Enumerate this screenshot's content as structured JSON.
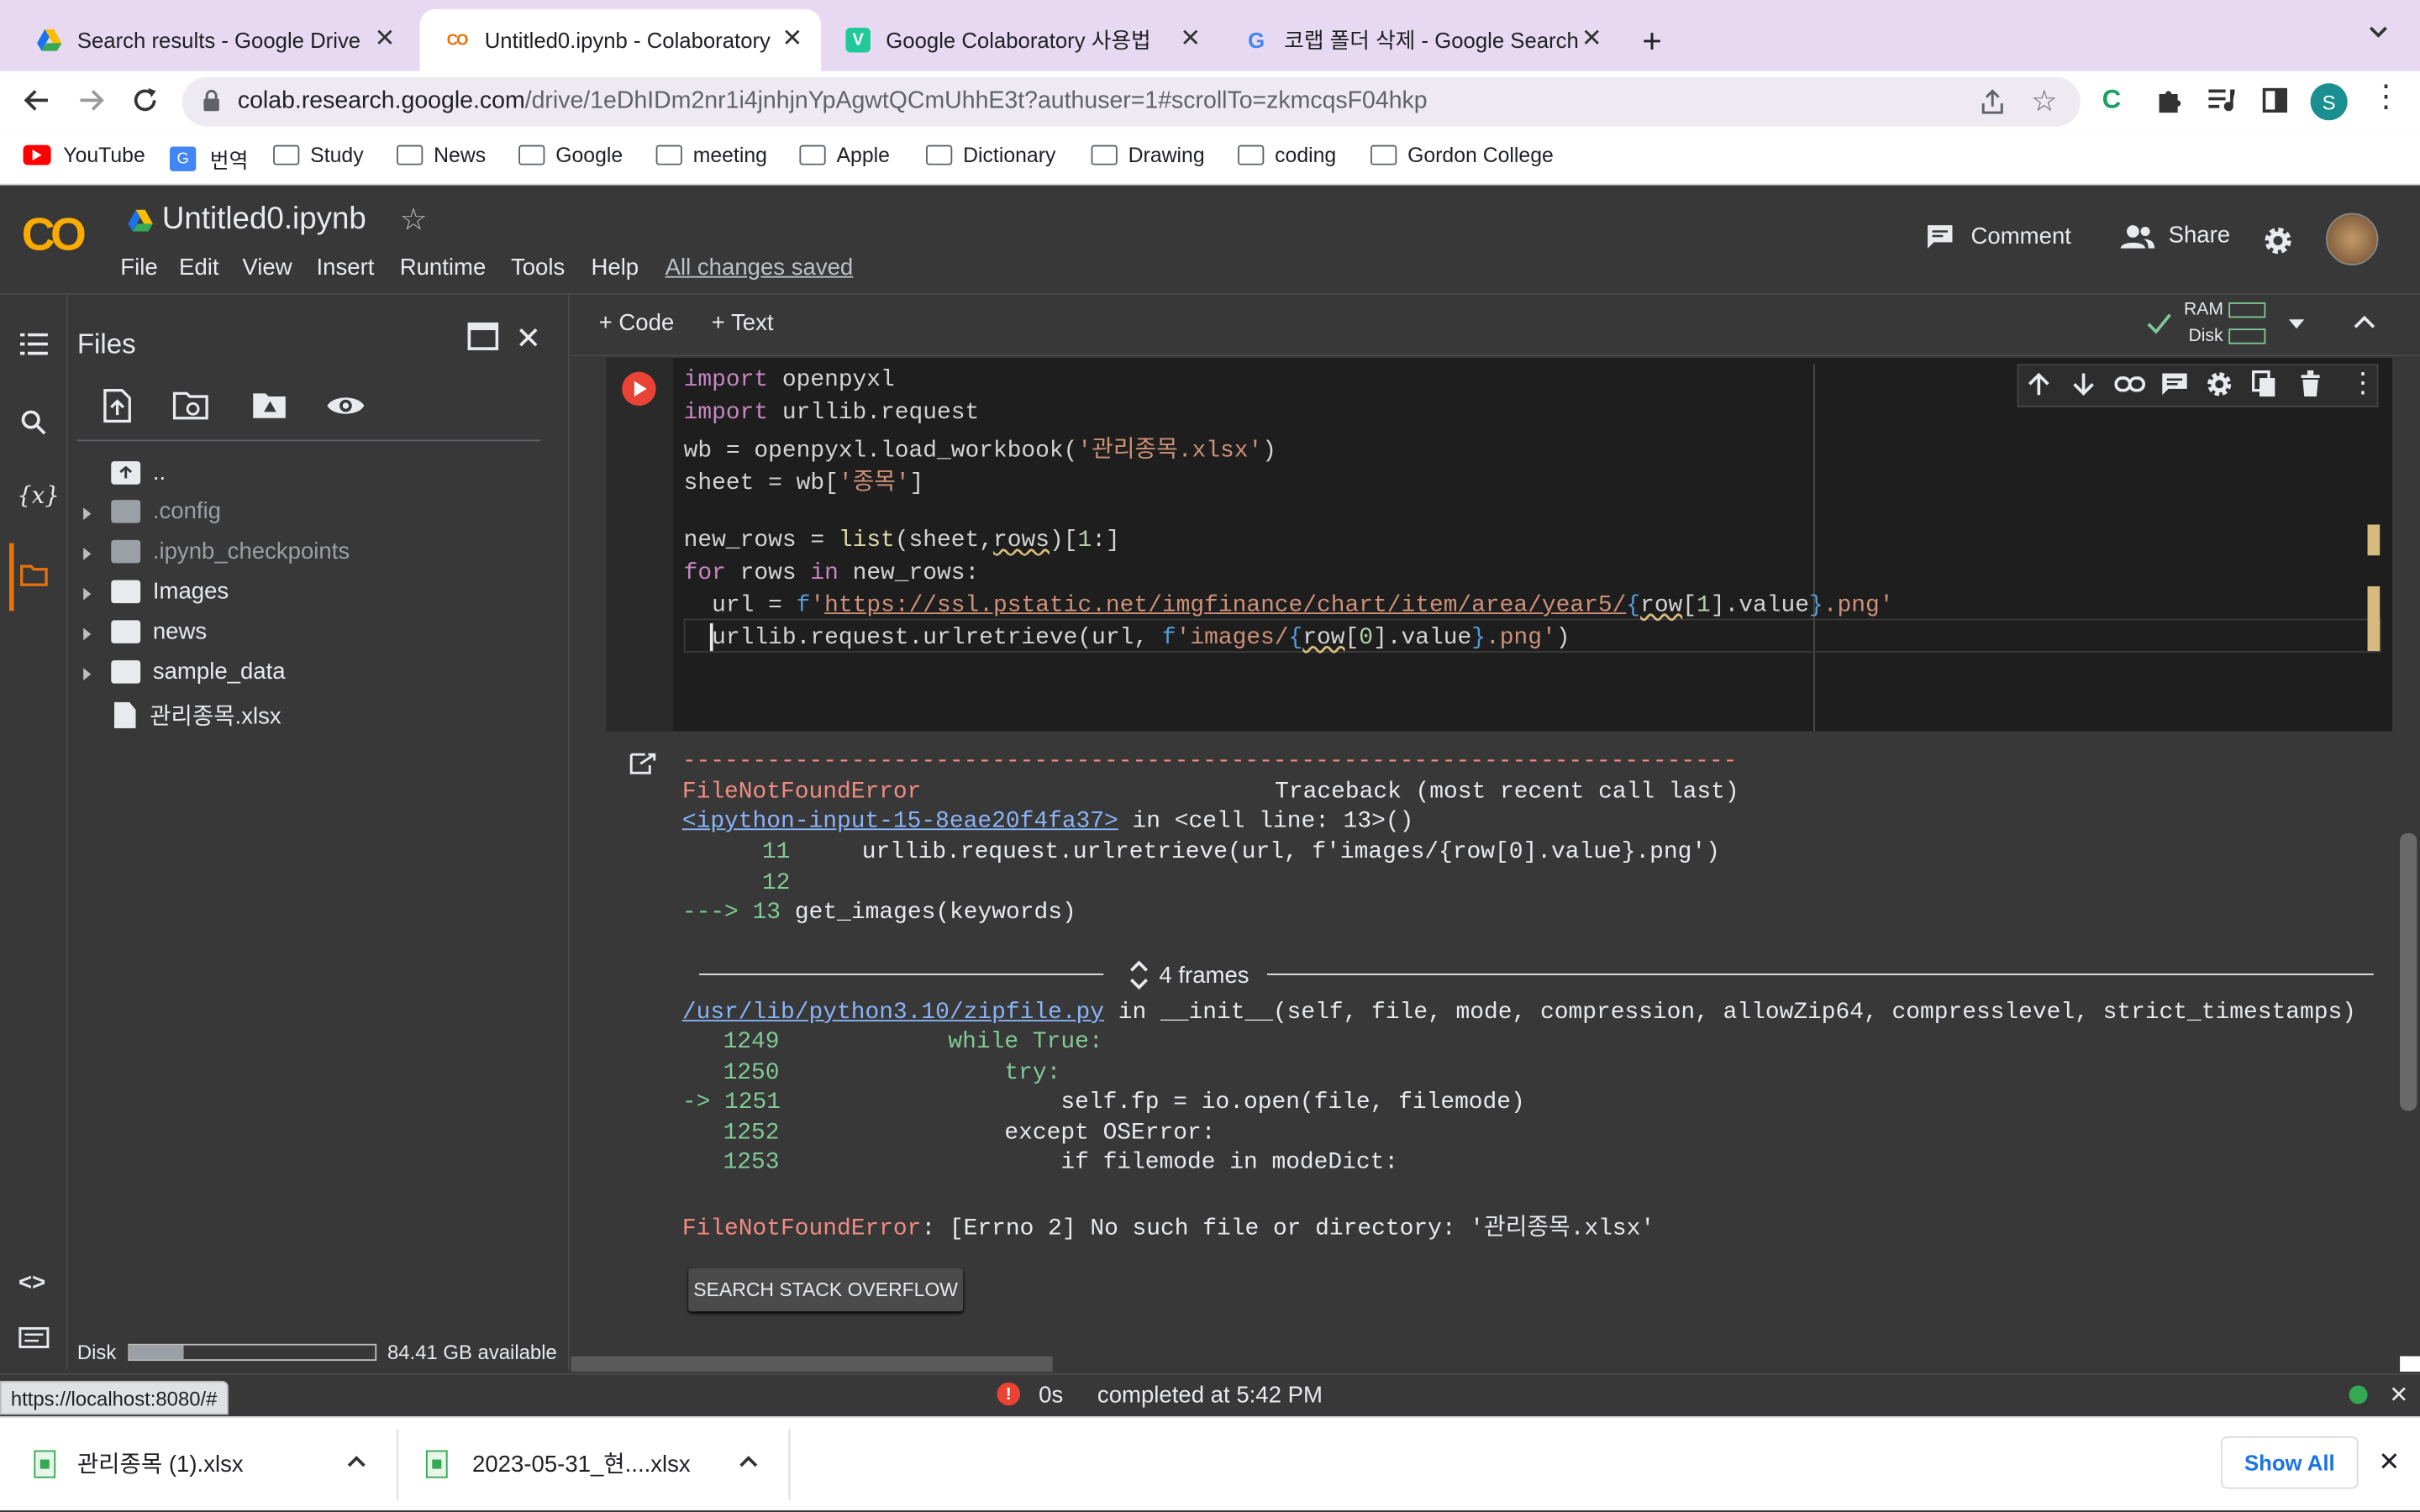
{
  "browser": {
    "tabs": [
      {
        "title": "Search results - Google Drive",
        "icon": "google-drive-icon"
      },
      {
        "title": "Untitled0.ipynb - Colaboratory",
        "icon": "colab-icon",
        "active": true
      },
      {
        "title": "Google Colaboratory 사용법",
        "icon": "velog-icon"
      },
      {
        "title": "코랩 폴더 삭제 - Google Search",
        "icon": "google-icon"
      }
    ],
    "url_host": "colab.research.google.com",
    "url_path": "/drive/1eDhIDm2nr1i4jnhjnYpAgwtQCmUhhE3t?authuser=1#scrollTo=zkmcqsF04hkp",
    "profile_initial": "S",
    "ext_letter": "C",
    "bookmarks": [
      "YouTube",
      "번역",
      "Study",
      "News",
      "Google",
      "meeting",
      "Apple",
      "Dictionary",
      "Drawing",
      "coding",
      "Gordon College"
    ]
  },
  "colab": {
    "logo": "CO",
    "notebook_name": "Untitled0.ipynb",
    "menu": [
      "File",
      "Edit",
      "View",
      "Insert",
      "Runtime",
      "Tools",
      "Help"
    ],
    "save_status": "All changes saved",
    "comment_label": "Comment",
    "share_label": "Share",
    "add_code_label": "+ Code",
    "add_text_label": "+ Text",
    "ram_label": "RAM",
    "disk_label": "Disk",
    "colors": {
      "background": "#383838",
      "accent": "#f9ab00",
      "error": "#f28b82",
      "link": "#8ab4f8"
    }
  },
  "files_panel": {
    "title": "Files",
    "items": [
      {
        "name": "..",
        "type": "up"
      },
      {
        "name": ".config",
        "type": "folder"
      },
      {
        "name": ".ipynb_checkpoints",
        "type": "folder"
      },
      {
        "name": "Images",
        "type": "folder"
      },
      {
        "name": "news",
        "type": "folder"
      },
      {
        "name": "sample_data",
        "type": "folder"
      },
      {
        "name": "관리종목.xlsx",
        "type": "file"
      }
    ],
    "disk_label": "Disk",
    "disk_available": "84.41 GB available",
    "disk_used_fraction": 0.22
  },
  "cell": {
    "code_lines": [
      "import openpyxl",
      "import urllib.request",
      "wb = openpyxl.load_workbook('관리종목.xlsx')",
      "sheet = wb['종목']",
      "",
      "new_rows = list(sheet,rows)[1:]",
      "for rows in new_rows:",
      "  url = f'https://ssl.pstatic.net/imgfinance/chart/item/area/year5/{row[1].value}.png'",
      "  urllib.request.urlretrieve(url, f'images/{row[0].value}.png')"
    ]
  },
  "output": {
    "dashes": "---------------------------------------------------------------------------",
    "error_name": "FileNotFoundError",
    "traceback_label": "Traceback (most recent call last)",
    "input_link": "<ipython-input-15-8eae20f4fa37>",
    "in_cell": "in <cell line: 13>()",
    "tb_lines": [
      {
        "num": "11",
        "text": "    urllib.request.urlretrieve(url, f'images/{row[0].value}.png')"
      },
      {
        "num": "12",
        "text": ""
      },
      {
        "num": "---> 13",
        "text": "get_images(keywords)"
      }
    ],
    "frames_label": "4 frames",
    "zip_link": "/usr/lib/python3.10/zipfile.py",
    "zip_sig": "in __init__(self, file, mode, compression, allowZip64, compresslevel, strict_timestamps)",
    "zip_lines": [
      {
        "num": "1249",
        "text": "            while True:"
      },
      {
        "num": "1250",
        "text": "                try:"
      },
      {
        "num": "-> 1251",
        "text": "                    self.fp = io.open(file, filemode)"
      },
      {
        "num": "1252",
        "text": "                except OSError:"
      },
      {
        "num": "1253",
        "text": "                    if filemode in modeDict:"
      }
    ],
    "final_error": "FileNotFoundError",
    "final_msg": ": [Errno 2] No such file or directory: '관리종목.xlsx'",
    "so_button": "SEARCH STACK OVERFLOW"
  },
  "status": {
    "hover_url": "https://localhost:8080/#",
    "elapsed": "0s",
    "completed": "completed at 5:42 PM"
  },
  "downloads": {
    "items": [
      "관리종목 (1).xlsx",
      "2023-05-31_현....xlsx"
    ],
    "show_all": "Show All"
  }
}
